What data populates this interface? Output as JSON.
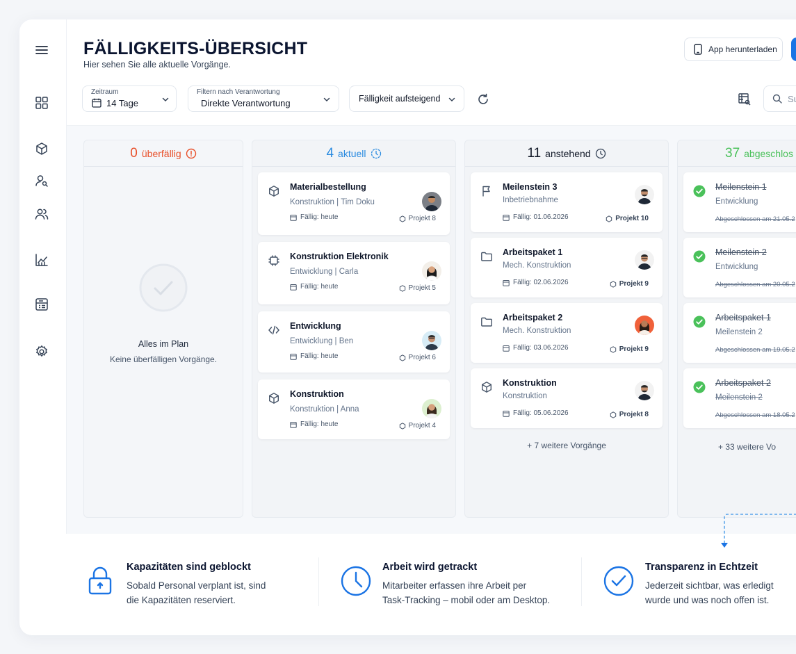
{
  "colors": {
    "accent_blue": "#1b74e4",
    "overdue_red": "#e8502a",
    "current_blue": "#2b8be0",
    "done_green": "#4ac15a",
    "text_dark": "#0b1530"
  },
  "header": {
    "title": "FÄLLIGKEITS-ÜBERSICHT",
    "subtitle": "Hier sehen Sie alle aktuelle Vorgänge.",
    "app_button": "App herunterladen"
  },
  "filters": {
    "zeitraum_label": "Zeitraum",
    "zeitraum_value": "14 Tage",
    "verantwortung_label": "Filtern nach Verantwortung",
    "verantwortung_value": "Direkte Verantwortung",
    "sort_value": "Fälligkeit aufsteigend",
    "search_placeholder": "Su"
  },
  "columns": [
    {
      "count": "0",
      "label": "überfällig",
      "empty_title": "Alles im Plan",
      "empty_text": "Keine überfälligen Vorgänge."
    },
    {
      "count": "4",
      "label": "aktuell",
      "cards": [
        {
          "icon": "cube-icon",
          "title": "Materialbestellung",
          "sub": "Konstruktion | Tim Doku",
          "due": "Fällig: heute",
          "project": "Projekt 8"
        },
        {
          "icon": "chip-icon",
          "title": "Konstruktion Elektronik",
          "sub": "Entwicklung | Carla",
          "due": "Fällig: heute",
          "project": "Projekt 5"
        },
        {
          "icon": "code-icon",
          "title": "Entwicklung",
          "sub": "Entwicklung | Ben",
          "due": "Fällig: heute",
          "project": "Projekt 6"
        },
        {
          "icon": "cube-icon",
          "title": "Konstruktion",
          "sub": "Konstruktion | Anna",
          "due": "Fällig: heute",
          "project": "Projekt 4"
        }
      ]
    },
    {
      "count": "11",
      "label": "anstehend",
      "cards": [
        {
          "icon": "flag-icon",
          "title": "Meilenstein 3",
          "sub": "Inbetriebnahme",
          "due": "Fällig: 01.06.2026",
          "project": "Projekt 10"
        },
        {
          "icon": "folder-icon",
          "title": "Arbeitspaket 1",
          "sub": "Mech. Konstruktion",
          "due": "Fällig: 02.06.2026",
          "project": "Projekt 9"
        },
        {
          "icon": "folder-icon",
          "title": "Arbeitspaket 2",
          "sub": "Mech. Konstruktion",
          "due": "Fällig: 03.06.2026",
          "project": "Projekt 9"
        },
        {
          "icon": "cube-icon",
          "title": "Konstruktion",
          "sub": "Konstruktion",
          "due": "Fällig: 05.06.2026",
          "project": "Projekt 8"
        }
      ],
      "more": "+ 7 weitere Vorgänge"
    },
    {
      "count": "37",
      "label": "abgeschlos",
      "cards": [
        {
          "title": "Meilenstein 1",
          "sub": "Entwicklung",
          "due": "Abgeschlossen am 21.05.2"
        },
        {
          "title": "Meilenstein 2",
          "sub": "Entwicklung",
          "due": "Abgeschlossen am 20.05.2"
        },
        {
          "title": "Arbeitspaket 1",
          "sub": "Meilenstein 2",
          "due": "Abgeschlossen am 19.05.2"
        },
        {
          "title": "Arbeitspaket 2",
          "sub": "Meilenstein 2",
          "due": "Abgeschlossen am 18.05.2"
        }
      ],
      "more": "+ 33 weitere Vo"
    }
  ],
  "features": [
    {
      "title": "Kapazitäten sind geblockt",
      "line1": "Sobald Personal verplant ist, sind",
      "line2": "die Kapazitäten reserviert."
    },
    {
      "title": "Arbeit wird getrackt",
      "line1": "Mitarbeiter erfassen ihre Arbeit per",
      "line2": "Task-Tracking – mobil oder am Desktop."
    },
    {
      "title": "Transparenz in Echtzeit",
      "line1": "Jederzeit sichtbar, was erledigt",
      "line2": "wurde und was noch offen ist."
    }
  ]
}
